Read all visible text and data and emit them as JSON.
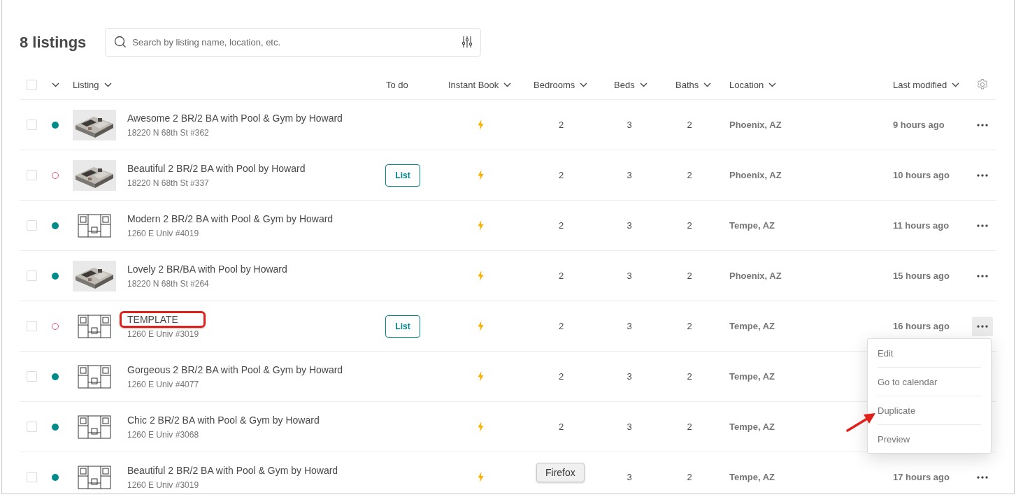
{
  "title": "8 listings",
  "search": {
    "placeholder": "Search by listing name, location, etc."
  },
  "table": {
    "select_all": {
      "checked": false
    },
    "columns": [
      {
        "label": "Listing",
        "sortable": true
      },
      {
        "label": "To do",
        "sortable": false
      },
      {
        "label": "Instant Book",
        "sortable": true
      },
      {
        "label": "Bedrooms",
        "sortable": true
      },
      {
        "label": "Beds",
        "sortable": true
      },
      {
        "label": "Baths",
        "sortable": true
      },
      {
        "label": "Location",
        "sortable": true
      },
      {
        "label": "Last modified",
        "sortable": true
      }
    ],
    "rows": [
      {
        "checked": false,
        "published": true,
        "kind": "render",
        "title": "Awesome 2 BR/2 BA with Pool & Gym by Howard",
        "highlighted": false,
        "address": "18220 N 68th St #362",
        "instant_book": true,
        "bedrooms": "2",
        "beds": "3",
        "baths": "2",
        "location": "Phoenix, AZ",
        "modified": "9 hours ago",
        "menu_open": false
      },
      {
        "checked": false,
        "published": false,
        "kind": "render",
        "title": "Beautiful 2 BR/2 BA with Pool by Howard",
        "highlighted": false,
        "address": "18220 N 68th St #337",
        "todo": "List",
        "instant_book": true,
        "bedrooms": "2",
        "beds": "3",
        "baths": "2",
        "location": "Phoenix, AZ",
        "modified": "10 hours ago",
        "menu_open": false
      },
      {
        "checked": false,
        "published": true,
        "kind": "plan",
        "title": "Modern 2 BR/2 BA with Pool & Gym by Howard",
        "highlighted": false,
        "address": "1260 E Univ #4019",
        "instant_book": true,
        "bedrooms": "2",
        "beds": "3",
        "baths": "2",
        "location": "Tempe, AZ",
        "modified": "11 hours ago",
        "menu_open": false
      },
      {
        "checked": false,
        "published": true,
        "kind": "render",
        "title": "Lovely 2 BR/BA with Pool by Howard",
        "highlighted": false,
        "address": "18220 N 68th St #264",
        "instant_book": true,
        "bedrooms": "2",
        "beds": "3",
        "baths": "2",
        "location": "Phoenix, AZ",
        "modified": "15 hours ago",
        "menu_open": false
      },
      {
        "checked": false,
        "published": false,
        "kind": "plan",
        "title": "TEMPLATE",
        "highlighted": true,
        "address": "1260 E Univ #3019",
        "todo": "List",
        "instant_book": true,
        "bedrooms": "2",
        "beds": "3",
        "baths": "2",
        "location": "Tempe, AZ",
        "modified": "16 hours ago",
        "menu_open": true
      },
      {
        "checked": false,
        "published": true,
        "kind": "plan",
        "title": "Gorgeous 2 BR/2 BA with Pool & Gym by Howard",
        "highlighted": false,
        "address": "1260 E Univ #4077",
        "instant_book": true,
        "bedrooms": "2",
        "beds": "3",
        "baths": "2",
        "location": "Tempe, AZ"
      },
      {
        "checked": false,
        "published": true,
        "kind": "plan",
        "title": "Chic 2 BR/2 BA with Pool & Gym by Howard",
        "highlighted": false,
        "address": "1260 E Univ #3068",
        "instant_book": true,
        "bedrooms": "2",
        "beds": "3",
        "baths": "2",
        "location": "Tempe, AZ"
      },
      {
        "checked": false,
        "published": true,
        "kind": "plan",
        "title": "Beautiful 2 BR/2 BA with Pool & Gym by Howard",
        "highlighted": false,
        "address": "1260 E Univ #3019",
        "instant_book": true,
        "beds": "3",
        "baths": "2",
        "location": "Tempe, AZ",
        "modified": "17 hours ago",
        "menu_open": false
      }
    ]
  },
  "row_menu": {
    "items": [
      "Edit",
      "Go to calendar",
      "Duplicate",
      "Preview"
    ]
  },
  "tooltip": "Firefox"
}
